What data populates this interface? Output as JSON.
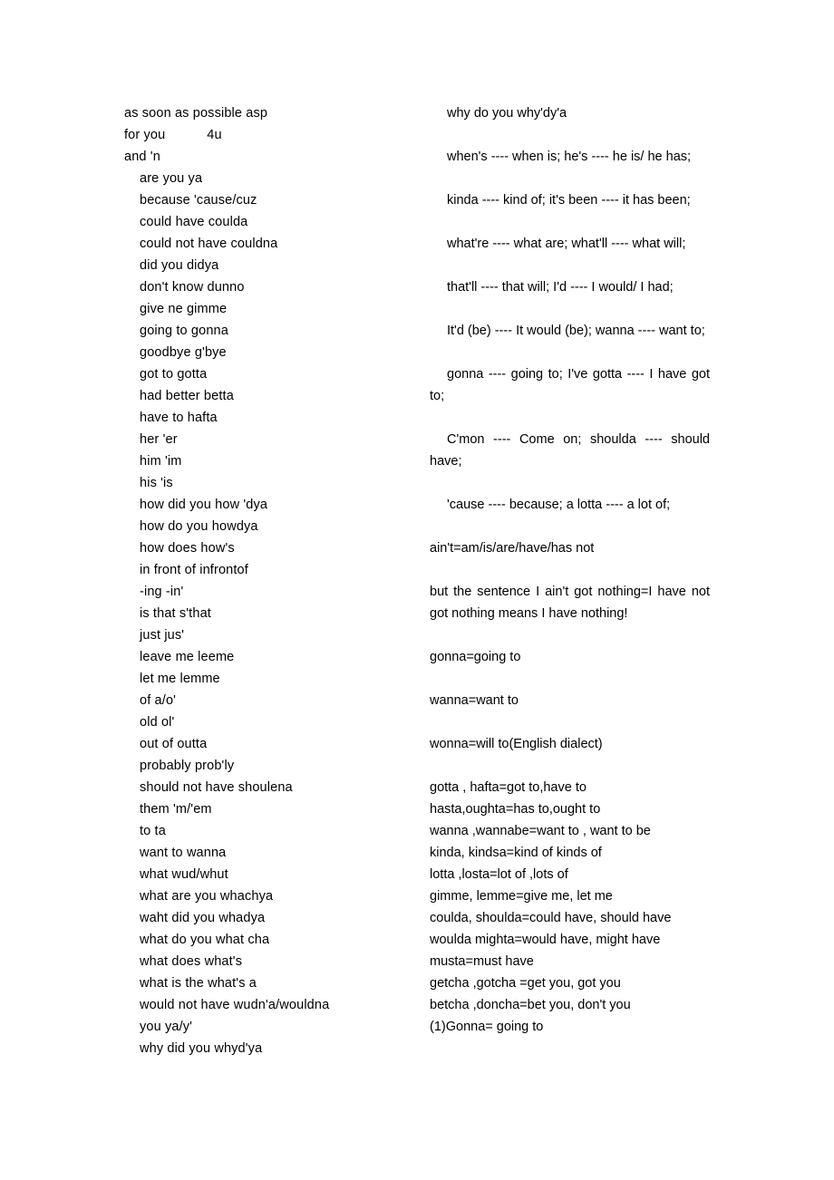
{
  "document": {
    "type": "contractions-and-reductions-reference-sheet",
    "background_color": "#ffffff",
    "text_color": "#000000"
  },
  "left_column": {
    "name": "contractions-list",
    "lines": [
      {
        "text": "as soon as possible asp",
        "indented": false
      },
      {
        "text": "for you           4u",
        "indented": false
      },
      {
        "text": "and 'n",
        "indented": false
      },
      {
        "text": "are you ya",
        "indented": true
      },
      {
        "text": "because 'cause/cuz",
        "indented": true
      },
      {
        "text": "could have coulda",
        "indented": true
      },
      {
        "text": "could not have couldna",
        "indented": true
      },
      {
        "text": "did you didya",
        "indented": true
      },
      {
        "text": "don't know dunno",
        "indented": true
      },
      {
        "text": "give ne gimme",
        "indented": true
      },
      {
        "text": "going to gonna",
        "indented": true
      },
      {
        "text": "goodbye g'bye",
        "indented": true
      },
      {
        "text": "got to gotta",
        "indented": true
      },
      {
        "text": "had better betta",
        "indented": true
      },
      {
        "text": "have to hafta",
        "indented": true
      },
      {
        "text": "her 'er",
        "indented": true
      },
      {
        "text": "him 'im",
        "indented": true
      },
      {
        "text": "his 'is",
        "indented": true
      },
      {
        "text": "how did you how 'dya",
        "indented": true
      },
      {
        "text": "how do you howdya",
        "indented": true
      },
      {
        "text": "how does how's",
        "indented": true
      },
      {
        "text": "in front of infrontof",
        "indented": true
      },
      {
        "text": "-ing -in'",
        "indented": true
      },
      {
        "text": "is that s'that",
        "indented": true
      },
      {
        "text": "just jus'",
        "indented": true
      },
      {
        "text": "leave me leeme",
        "indented": true
      },
      {
        "text": "let me lemme",
        "indented": true
      },
      {
        "text": "of a/o'",
        "indented": true
      },
      {
        "text": "old ol'",
        "indented": true
      },
      {
        "text": "out of outta",
        "indented": true
      },
      {
        "text": "probably prob'ly",
        "indented": true
      },
      {
        "text": "should not have shoulena",
        "indented": true
      },
      {
        "text": "them 'm/'em",
        "indented": true
      },
      {
        "text": "to ta",
        "indented": true
      },
      {
        "text": "want to wanna",
        "indented": true
      },
      {
        "text": "what wud/whut",
        "indented": true
      },
      {
        "text": "what are you whachya",
        "indented": true
      },
      {
        "text": "waht did you whadya",
        "indented": true
      },
      {
        "text": "what do you what cha",
        "indented": true
      },
      {
        "text": "what does what's",
        "indented": true
      },
      {
        "text": "what is the what's a",
        "indented": true
      },
      {
        "text": "would not have wudn'a/wouldna",
        "indented": true
      },
      {
        "text": "you ya/y'",
        "indented": true
      },
      {
        "text": "why did you whyd'ya",
        "indented": true
      }
    ]
  },
  "right_column": {
    "name": "reductions-notes",
    "paragraphs": [
      {
        "id": "p1",
        "text": "why do you why'dy'a",
        "indent": true,
        "gap": true,
        "justify": true
      },
      {
        "id": "p2",
        "text": "when's ---- when is; he's ---- he is/ he has;",
        "indent": true,
        "gap": true,
        "justify": true
      },
      {
        "id": "p3",
        "text": "kinda ---- kind of; it's been ---- it has been;",
        "indent": true,
        "gap": true,
        "justify": true
      },
      {
        "id": "p4",
        "text": "what're ---- what are; what'll ---- what will;",
        "indent": true,
        "gap": true,
        "justify": true
      },
      {
        "id": "p5",
        "text": "that'll ---- that will; I'd ---- I would/ I had;",
        "indent": true,
        "gap": true,
        "justify": true
      },
      {
        "id": "p6",
        "text": "It'd (be) ---- It would (be); wanna ---- want to;",
        "indent": true,
        "gap": true,
        "justify": true
      },
      {
        "id": "p7",
        "text": "gonna ---- going to; I've gotta ---- I have got to;",
        "indent": true,
        "gap": true,
        "justify": true
      },
      {
        "id": "p8",
        "text": "C'mon ---- Come on; shoulda ---- should have;",
        "indent": true,
        "gap": true,
        "justify": true
      },
      {
        "id": "p9",
        "text": "'cause ---- because; a lotta ---- a lot of;",
        "indent": true,
        "gap": true,
        "justify": true
      },
      {
        "id": "p10",
        "text": "ain't=am/is/are/have/has not",
        "indent": false,
        "gap": true,
        "justify": true
      },
      {
        "id": "p11",
        "text": "but the sentence I ain't got nothing=I have not got nothing means I have nothing!",
        "indent": false,
        "gap": true,
        "justify": true
      },
      {
        "id": "p12",
        "text": "gonna=going to",
        "indent": false,
        "gap": true,
        "justify": true
      },
      {
        "id": "p13",
        "text": "wanna=want to",
        "indent": false,
        "gap": true,
        "justify": true
      },
      {
        "id": "p14",
        "text": "wonna=will to(English dialect)",
        "indent": false,
        "gap": true,
        "justify": true
      }
    ],
    "tight_lines": [
      "gotta , hafta=got to,have to",
      "hasta,oughta=has to,ought to",
      "wanna ,wannabe=want to , want to be",
      "kinda, kindsa=kind of kinds of",
      "lotta ,losta=lot of ,lots of",
      "gimme, lemme=give me, let me",
      "coulda, shoulda=could have, should have",
      "woulda mighta=would have, might have",
      "musta=must have",
      "getcha ,gotcha =get you, got you",
      "betcha ,doncha=bet you, don't you",
      "(1)Gonna= going to"
    ]
  }
}
